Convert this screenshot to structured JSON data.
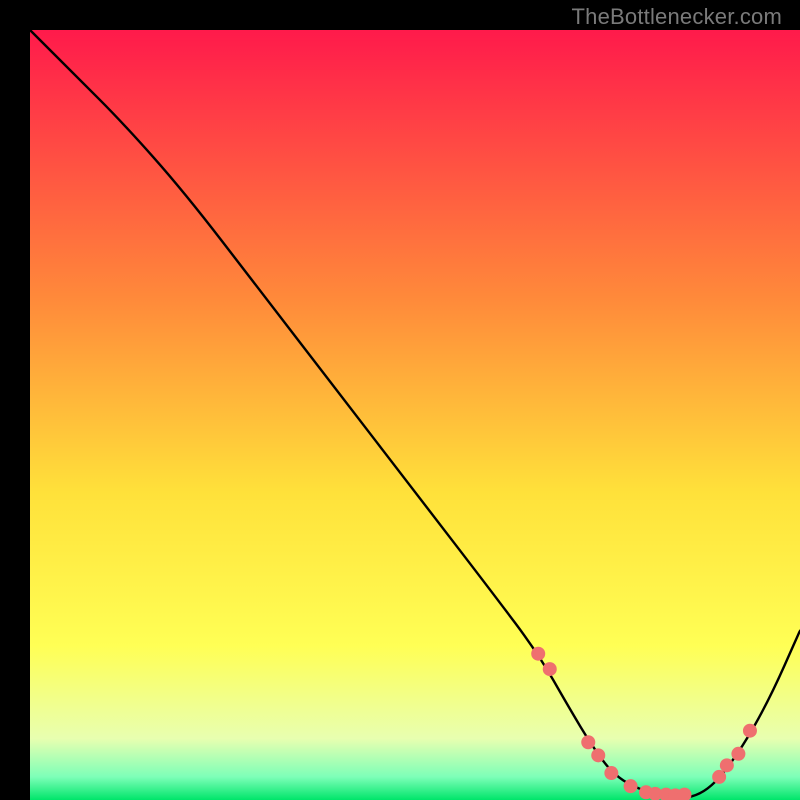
{
  "watermark": "TheBottlenecker.com",
  "chart_data": {
    "type": "line",
    "title": "",
    "xlabel": "",
    "ylabel": "",
    "xlim": [
      0,
      100
    ],
    "ylim": [
      0,
      100
    ],
    "background_gradient": {
      "stops": [
        {
          "offset": 0.0,
          "color": "#ff1a4b"
        },
        {
          "offset": 0.35,
          "color": "#ff8a3a"
        },
        {
          "offset": 0.6,
          "color": "#ffe13a"
        },
        {
          "offset": 0.8,
          "color": "#ffff55"
        },
        {
          "offset": 0.92,
          "color": "#e8ffb0"
        },
        {
          "offset": 0.97,
          "color": "#7dffb8"
        },
        {
          "offset": 1.0,
          "color": "#00e56a"
        }
      ]
    },
    "series": [
      {
        "name": "bottleneck-curve",
        "x": [
          0,
          6,
          12,
          20,
          30,
          40,
          50,
          60,
          66,
          70,
          73,
          76,
          80,
          84,
          88,
          92,
          96,
          100
        ],
        "y": [
          100,
          94,
          88,
          79,
          66,
          53,
          40,
          27,
          19,
          12,
          7,
          3,
          1,
          0,
          1,
          6,
          13,
          22
        ]
      }
    ],
    "markers": {
      "name": "sweet-spot-dots",
      "x": [
        66,
        67.5,
        72.5,
        73.8,
        75.5,
        78,
        80,
        81.2,
        82.6,
        83.8,
        85,
        89.5,
        90.5,
        92,
        93.5
      ],
      "y": [
        19,
        17,
        7.5,
        5.8,
        3.5,
        1.8,
        1.0,
        0.8,
        0.7,
        0.6,
        0.7,
        3.0,
        4.5,
        6.0,
        9.0
      ],
      "color": "#ef6f6f",
      "radius": 7
    }
  }
}
